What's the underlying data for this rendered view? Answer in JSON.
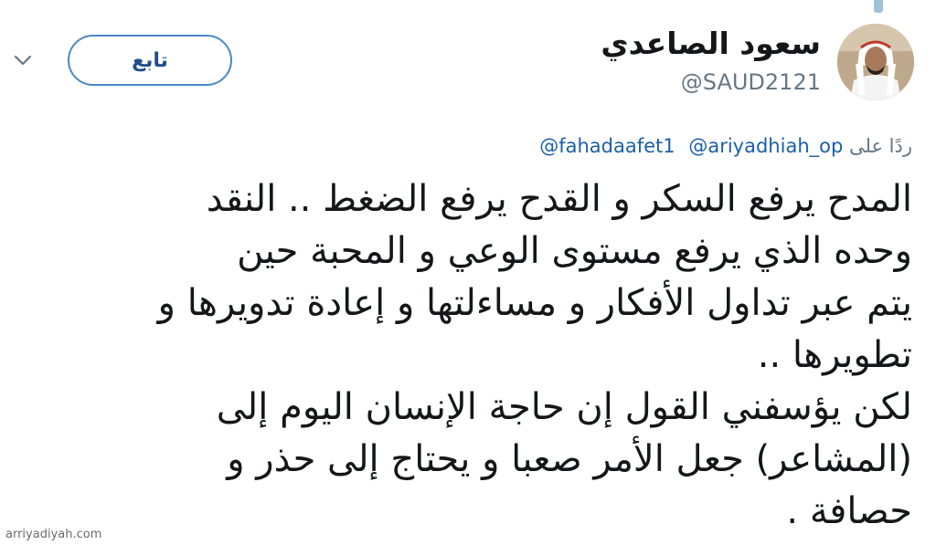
{
  "user": {
    "display_name": "سعود الصاعدي",
    "handle": "@SAUD2121",
    "avatar_icon": "user-avatar-photo"
  },
  "follow_button": {
    "label": "تابع"
  },
  "menu": {
    "icon": "chevron-down-icon"
  },
  "reply": {
    "prefix": "ردًا على",
    "mentions": [
      "@ariyadhiah_op",
      "@fahadaafet1"
    ]
  },
  "tweet": {
    "lines": [
      "المدح يرفع السكر و القدح يرفع الضغط .. النقد",
      "وحده الذي يرفع مستوى الوعي و المحبة حين",
      "يتم عبر تداول الأفكار و مساءلتها و إعادة تدويرها و",
      "تطويرها ..",
      "لكن يؤسفني القول إن حاجة الإنسان اليوم إلى",
      "(المشاعر) جعل الأمر صعبا و يحتاج إلى حذر و",
      "حصافة ."
    ]
  },
  "watermark": "arriyadiyah.com",
  "colors": {
    "follow_border": "#4a89c4",
    "mention": "#1b5fa8",
    "muted": "#657786",
    "text": "#14171a"
  }
}
